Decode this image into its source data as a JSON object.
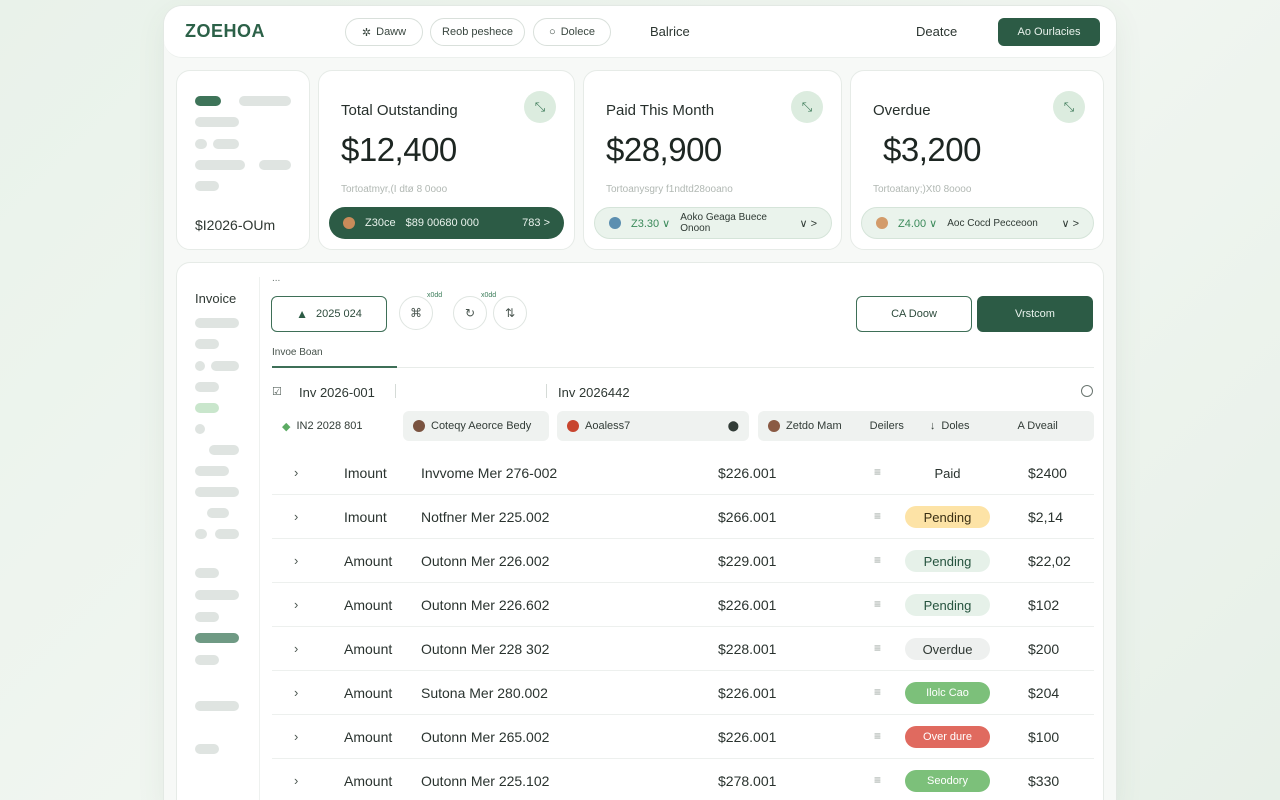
{
  "app": {
    "logo": "ZOEHOA",
    "nav_pills": [
      "Dаww",
      "Reob peshece",
      "Dolece"
    ],
    "nav_link_1": "Balrice",
    "nav_link_2": "Deatce",
    "cta": "Ao Ourlacies"
  },
  "left_card": {
    "value": "$I2026-OUm"
  },
  "cards": [
    {
      "title": "Total Outstanding",
      "value": "$12,400",
      "note": "Tortoatmyr,(I dtø 8 0ooo",
      "bar_left": "Z30ce",
      "bar_mid": "$89 00680 000",
      "bar_right": "783 >"
    },
    {
      "title": "Paid This Month",
      "value": "$28,900",
      "note": "Tortoanysgry f1ndtd28ooano",
      "bar_left": "Z3.30 ∨",
      "bar_mid": "Aoko Geaga Buece Onoon",
      "bar_right": "∨ >"
    },
    {
      "title": "Overdue",
      "value": "$3,200",
      "note": "Tortoatany;)Xt0 8oooo",
      "bar_left": "Z4.00 ∨",
      "bar_mid": "Aoc Cocd Pecceoon",
      "bar_right": "∨ >"
    }
  ],
  "panel": {
    "side_title": "Invoice",
    "dots": "...",
    "date_button": "2025 024",
    "tiny_label_1": "x0dd",
    "tiny_label_2": "x0dd",
    "outline_button": "CA Doow",
    "solid_button": "Vrstcom",
    "tab_label": "Invoe Boan",
    "head_left": "Inv 2026-001",
    "head_right": "Inv 2026442",
    "filters": {
      "f1": "IN2 2028 801",
      "f2": "Coteqy Aeorce Bedy",
      "f3": "Aoaless7",
      "f4": "Zetdo Mam",
      "f5": "Deilers",
      "f6": "Doles",
      "f7": "A Dveail"
    }
  },
  "rows": [
    {
      "type": "Imount",
      "name": "Invvome Mer 276-002",
      "amount": "$226.001",
      "status": "Paid",
      "total": "$2400"
    },
    {
      "type": "Imount",
      "name": "Notfner Mer 225.002",
      "amount": "$266.001",
      "status": "Pending",
      "total": "$2,14"
    },
    {
      "type": "Amount",
      "name": "Outonn Mer 226.002",
      "amount": "$229.001",
      "status": "Pending",
      "total": "$22,02"
    },
    {
      "type": "Amount",
      "name": "Outonn Mer 226.602",
      "amount": "$226.001",
      "status": "Pending",
      "total": "$102"
    },
    {
      "type": "Amount",
      "name": "Outonn Mer 228 302",
      "amount": "$228.001",
      "status": "Overdue",
      "total": "$200"
    },
    {
      "type": "Amount",
      "name": "Sutona Mer 280.002",
      "amount": "$226.001",
      "status": "Ilolc Cao",
      "total": "$204"
    },
    {
      "type": "Amount",
      "name": "Outonn Mer 265.002",
      "amount": "$226.001",
      "status": "Over dure",
      "total": "$100"
    },
    {
      "type": "Amount",
      "name": "Outonn Mer 225.102",
      "amount": "$278.001",
      "status": "Seodory",
      "total": "$330"
    }
  ],
  "colors": {
    "brand": "#2c5b45",
    "pending_yellow": "#fde3a6",
    "pending_green": "#e6f1e9",
    "status_green": "#7cc07a",
    "status_red": "#e06a5f"
  }
}
